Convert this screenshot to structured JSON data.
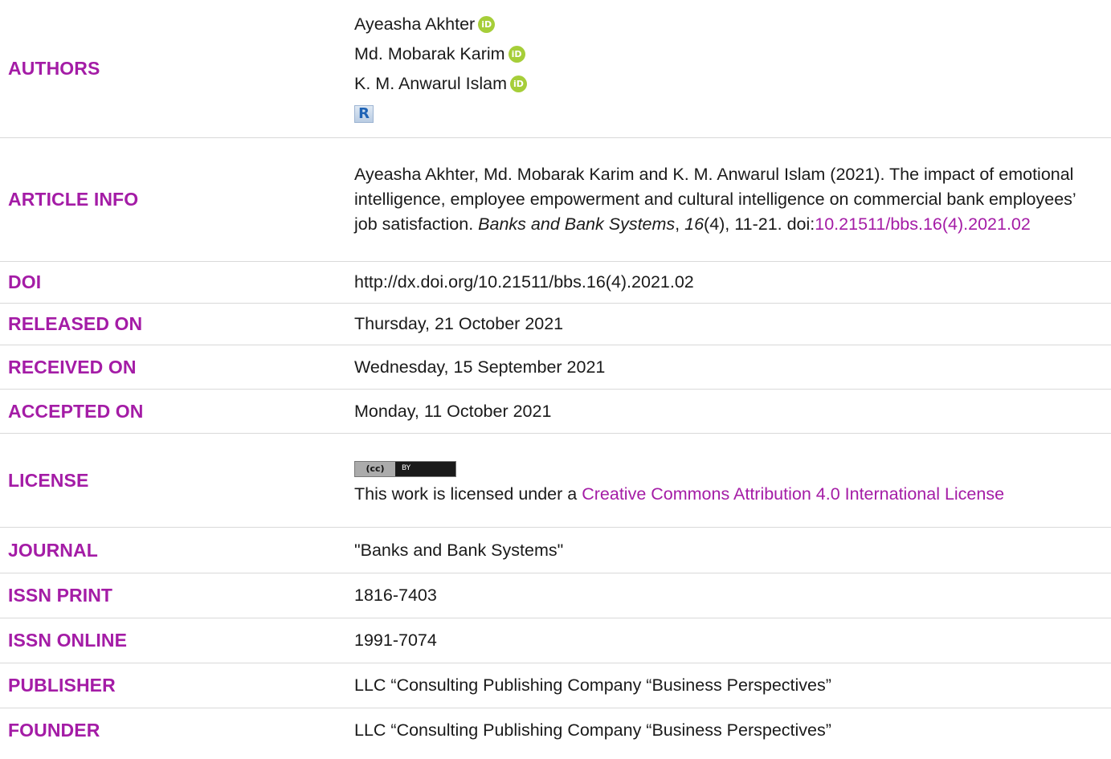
{
  "authors": {
    "label": "AUTHORS",
    "list": [
      {
        "name": "Ayeasha Akhter",
        "orcid": "iD"
      },
      {
        "name": "Md. Mobarak Karim",
        "orcid": "iD"
      },
      {
        "name": "K. M. Anwarul Islam",
        "orcid": "iD"
      }
    ],
    "researchgate_icon": "R"
  },
  "article_info": {
    "label": "ARTICLE INFO",
    "citation_text": "Ayeasha Akhter, Md. Mobarak Karim and K. M. Anwarul Islam (2021). The impact of emotional intelligence, employee empowerment and cultural intelligence on commercial bank employees’ job satisfaction. ",
    "journal_italic": "Banks and Bank Systems",
    "sep1": ", ",
    "volume_italic": "16",
    "issue_pages": "(4), 11-21. doi:",
    "doi_link": "10.21511/bbs.16(4).2021.02"
  },
  "doi": {
    "label": "DOI",
    "value": "http://dx.doi.org/10.21511/bbs.16(4).2021.02"
  },
  "released": {
    "label": "RELEASED ON",
    "value": "Thursday, 21 October 2021"
  },
  "received": {
    "label": "RECEIVED ON",
    "value": "Wednesday, 15 September 2021"
  },
  "accepted": {
    "label": "ACCEPTED ON",
    "value": "Monday, 11 October 2021"
  },
  "license": {
    "label": "LICENSE",
    "badge_left": "(cc)",
    "badge_right": "BY",
    "text": "This work is licensed under a ",
    "link": "Creative Commons Attribution 4.0 International License"
  },
  "journal": {
    "label": "JOURNAL",
    "value": "\"Banks and Bank Systems\""
  },
  "issn_print": {
    "label": "ISSN PRINT",
    "value": "1816-7403"
  },
  "issn_online": {
    "label": "ISSN ONLINE",
    "value": "1991-7074"
  },
  "publisher": {
    "label": "PUBLISHER",
    "value": "LLC “Consulting Publishing Company “Business Perspectives”"
  },
  "founder": {
    "label": "FOUNDER",
    "value": "LLC “Consulting Publishing Company “Business Perspectives”"
  },
  "colors": {
    "accent": "#a41ca6",
    "orcid": "#a6ce39",
    "divider": "#d9d9d9"
  },
  "icons": [
    "orcid-icon",
    "researchgate-icon",
    "cc-by-license-icon"
  ]
}
